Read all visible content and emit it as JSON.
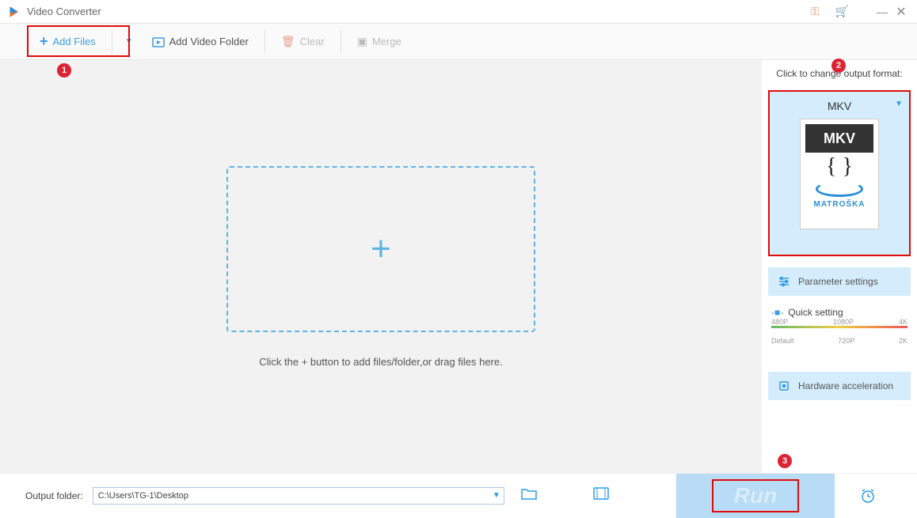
{
  "titlebar": {
    "title": "Video Converter"
  },
  "toolbar": {
    "add_files": "Add Files",
    "add_folder": "Add Video Folder",
    "clear": "Clear",
    "merge": "Merge"
  },
  "badges": {
    "one": "1",
    "two": "2",
    "three": "3"
  },
  "stage": {
    "hint": "Click the + button to add files/folder,or drag files here."
  },
  "rpanel": {
    "hint": "Click to change output format:",
    "format_label": "MKV",
    "format_card": {
      "top": "MKV",
      "braces": "{ }",
      "brand": "MATROŠKA"
    },
    "parameter": "Parameter settings",
    "quick_setting": "Quick setting",
    "ticks_top": [
      "480P",
      "1080P",
      "4K"
    ],
    "ticks_bot": [
      "Default",
      "720P",
      "2K"
    ],
    "hwaccel": "Hardware acceleration"
  },
  "bottombar": {
    "label": "Output folder:",
    "path": "C:\\Users\\TG-1\\Desktop",
    "run": "Run"
  }
}
